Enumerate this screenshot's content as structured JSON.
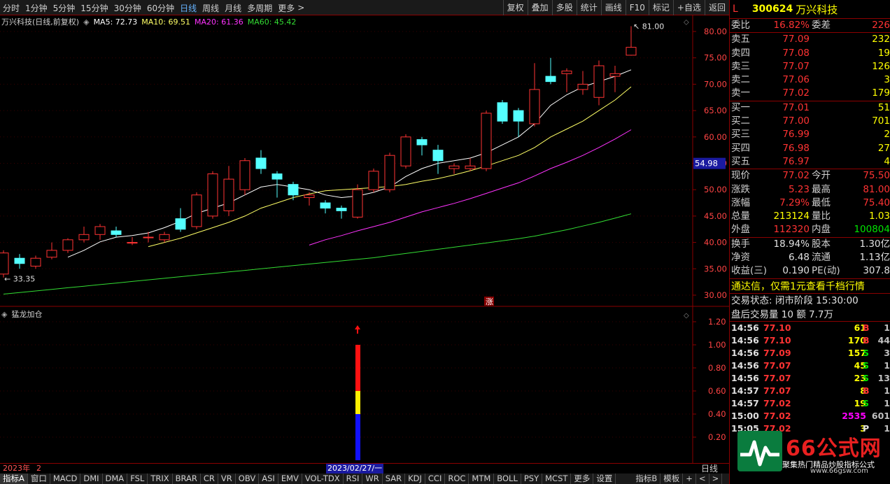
{
  "toolbar": {
    "periods": [
      "分时",
      "1分钟",
      "5分钟",
      "15分钟",
      "30分钟",
      "60分钟",
      "日线",
      "周线",
      "月线",
      "多周期",
      "更多"
    ],
    "active_period": "日线",
    "tools": [
      "复权",
      "叠加",
      "多股",
      "统计",
      "画线",
      "F10",
      "标记",
      "+自选",
      "返回"
    ]
  },
  "chart_info": {
    "title": "万兴科技(日线,前复权)",
    "ma5": "MA5: 72.73",
    "ma10": "MA10: 69.51",
    "ma20": "MA20: 61.36",
    "ma60": "MA60: 45.42"
  },
  "colors": {
    "up": "#ff3333",
    "down": "#54ffff",
    "ma5": "#ffffff",
    "ma10": "#ffff66",
    "ma20": "#ff33ff",
    "ma60": "#33dd33",
    "axis": "#8b0000"
  },
  "price_axis": {
    "ticks": [
      "80.00",
      "75.00",
      "70.00",
      "65.00",
      "60.00",
      "55.00",
      "50.00",
      "45.00",
      "40.00",
      "35.00",
      "30.00"
    ],
    "current_marker": "54.98"
  },
  "annotations": {
    "high_label": "81.00",
    "low_label": "33.35",
    "zhang_badge": "涨"
  },
  "indicator": {
    "title": "猛龙加仓",
    "ticks": [
      "1.20",
      "1.00",
      "0.80",
      "0.60",
      "0.40",
      "0.20"
    ]
  },
  "date_bar": {
    "year": "2023年",
    "count": "2",
    "cursor_date": "2023/02/27/一",
    "right_label": "日线"
  },
  "tabs": [
    "指标A",
    "窗口",
    "MACD",
    "DMI",
    "DMA",
    "FSL",
    "TRIX",
    "BRAR",
    "CR",
    "VR",
    "OBV",
    "ASI",
    "EMV",
    "VOL-TDX",
    "RSI",
    "WR",
    "SAR",
    "KDJ",
    "CCI",
    "ROC",
    "MTM",
    "BOLL",
    "PSY",
    "MCST",
    "更多",
    "设置",
    "指标B",
    "模板",
    "+",
    "<",
    ">"
  ],
  "stock": {
    "flag": "L",
    "code": "300624",
    "name": "万兴科技"
  },
  "order_book": {
    "weibi_label": "委比",
    "weibi_value": "16.82%",
    "weicha_label": "委差",
    "weicha_value": "226",
    "sell": [
      {
        "label": "卖五",
        "price": "77.09",
        "vol": "232"
      },
      {
        "label": "卖四",
        "price": "77.08",
        "vol": "19"
      },
      {
        "label": "卖三",
        "price": "77.07",
        "vol": "126"
      },
      {
        "label": "卖二",
        "price": "77.06",
        "vol": "3"
      },
      {
        "label": "卖一",
        "price": "77.02",
        "vol": "179"
      }
    ],
    "buy": [
      {
        "label": "买一",
        "price": "77.01",
        "vol": "51"
      },
      {
        "label": "买二",
        "price": "77.00",
        "vol": "701"
      },
      {
        "label": "买三",
        "price": "76.99",
        "vol": "2"
      },
      {
        "label": "买四",
        "price": "76.98",
        "vol": "27"
      },
      {
        "label": "买五",
        "price": "76.97",
        "vol": "4"
      }
    ]
  },
  "quote": [
    {
      "l1": "现价",
      "v1": "77.02",
      "l2": "今开",
      "v2": "75.50"
    },
    {
      "l1": "涨跌",
      "v1": "5.23",
      "l2": "最高",
      "v2": "81.00"
    },
    {
      "l1": "涨幅",
      "v1": "7.29%",
      "l2": "最低",
      "v2": "75.40"
    },
    {
      "l1": "总量",
      "v1": "213124",
      "l2": "量比",
      "v2": "1.03"
    },
    {
      "l1": "外盘",
      "v1": "112320",
      "l2": "内盘",
      "v2": "100804"
    }
  ],
  "fundamentals": [
    {
      "l1": "换手",
      "v1": "18.94%",
      "l2": "股本",
      "v2": "1.30亿"
    },
    {
      "l1": "净资",
      "v1": "6.48",
      "l2": "流通",
      "v2": "1.13亿"
    },
    {
      "l1": "收益(三)",
      "v1": "0.190",
      "l2": "PE(动)",
      "v2": "307.8"
    }
  ],
  "banner": "通达信，仅需1元查看千档行情",
  "trade_status": "交易状态: 闭市阶段 15:30:00",
  "after_hours": "盘后交易量 10 额 7.7万",
  "ticks_list": [
    {
      "t": "14:56",
      "p": "77.10",
      "v": "61",
      "s": "B",
      "n": "1"
    },
    {
      "t": "14:56",
      "p": "77.10",
      "v": "170",
      "s": "B",
      "n": "44"
    },
    {
      "t": "14:56",
      "p": "77.09",
      "v": "157",
      "s": "S",
      "n": "3"
    },
    {
      "t": "14:56",
      "p": "77.07",
      "v": "45",
      "s": "S",
      "n": "1"
    },
    {
      "t": "14:56",
      "p": "77.07",
      "v": "23",
      "s": "S",
      "n": "13"
    },
    {
      "t": "14:57",
      "p": "77.07",
      "v": "8",
      "s": "B",
      "n": "1"
    },
    {
      "t": "14:57",
      "p": "77.02",
      "v": "19",
      "s": "S",
      "n": "1"
    },
    {
      "t": "15:00",
      "p": "77.02",
      "v": "2535",
      "s": "",
      "n": "601"
    },
    {
      "t": "15:05",
      "p": "77.02",
      "v": "3",
      "s": "P",
      "n": "1"
    }
  ],
  "watermark": {
    "brand": "66公式网",
    "slogan": "聚集热门精品炒股指标公式",
    "url": "www.66gsw.com"
  },
  "candles": [
    [
      34.0,
      38.0,
      38.5,
      33.35
    ],
    [
      37.0,
      36.0,
      37.8,
      35.0
    ],
    [
      35.5,
      37.0,
      37.5,
      35.0
    ],
    [
      37.2,
      38.5,
      40.0,
      36.8
    ],
    [
      38.5,
      40.5,
      40.8,
      38.0
    ],
    [
      40.5,
      41.5,
      43.0,
      40.0
    ],
    [
      41.5,
      43.0,
      43.5,
      40.5
    ],
    [
      42.2,
      41.5,
      43.0,
      41.0
    ],
    [
      40.0,
      40.0,
      41.0,
      39.5
    ],
    [
      41.0,
      41.0,
      42.0,
      40.0
    ],
    [
      40.5,
      41.5,
      42.0,
      40.0
    ],
    [
      44.5,
      42.5,
      46.5,
      42.0
    ],
    [
      43.0,
      49.0,
      49.5,
      42.5
    ],
    [
      45.0,
      53.0,
      53.5,
      44.5
    ],
    [
      46.0,
      52.0,
      54.5,
      45.0
    ],
    [
      50.0,
      55.5,
      56.0,
      49.0
    ],
    [
      56.0,
      54.0,
      57.5,
      53.0
    ],
    [
      53.0,
      52.0,
      53.5,
      48.5
    ],
    [
      51.0,
      49.0,
      51.5,
      48.0
    ],
    [
      48.5,
      49.0,
      49.5,
      47.0
    ],
    [
      47.5,
      46.5,
      48.0,
      45.5
    ],
    [
      46.5,
      46.0,
      47.0,
      44.5
    ],
    [
      44.8,
      50.0,
      51.0,
      44.5
    ],
    [
      50.0,
      53.5,
      54.0,
      49.5
    ],
    [
      50.0,
      56.5,
      57.0,
      49.5
    ],
    [
      54.5,
      60.0,
      60.5,
      54.0
    ],
    [
      59.5,
      58.5,
      60.0,
      56.5
    ],
    [
      57.5,
      55.5,
      58.5,
      53.0
    ],
    [
      54.0,
      54.5,
      55.0,
      53.0
    ],
    [
      54.0,
      54.5,
      56.0,
      53.5
    ],
    [
      54.0,
      64.5,
      65.0,
      53.5
    ],
    [
      66.5,
      63.0,
      67.0,
      62.5
    ],
    [
      65.0,
      63.0,
      65.5,
      60.0
    ],
    [
      62.5,
      69.0,
      74.0,
      62.0
    ],
    [
      71.5,
      70.5,
      75.0,
      70.0
    ],
    [
      72.0,
      72.5,
      73.0,
      68.5
    ],
    [
      69.0,
      70.0,
      72.5,
      68.0
    ],
    [
      67.5,
      73.5,
      74.5,
      66.0
    ],
    [
      71.5,
      72.0,
      73.5,
      68.5
    ],
    [
      75.5,
      77.0,
      81.0,
      75.4
    ]
  ],
  "ma": {
    "ma5": [
      null,
      null,
      null,
      null,
      37.2,
      38.5,
      40.1,
      41.0,
      41.3,
      41.8,
      42.8,
      44.0,
      45.5,
      46.5,
      47.5,
      49.0,
      50.5,
      51.0,
      50.5,
      50.0,
      49.0,
      48.5,
      48.8,
      49.5,
      50.5,
      52.5,
      54.0,
      55.0,
      55.5,
      56.0,
      57.0,
      58.5,
      60.0,
      62.5,
      66.0,
      68.0,
      69.5,
      70.5,
      71.5,
      72.73
    ],
    "ma10": [
      null,
      null,
      null,
      null,
      null,
      null,
      null,
      null,
      null,
      39.2,
      40.0,
      40.8,
      41.8,
      42.8,
      43.8,
      45.0,
      46.5,
      47.5,
      48.5,
      49.2,
      49.8,
      50.0,
      50.2,
      50.4,
      50.6,
      51.0,
      51.6,
      52.1,
      52.8,
      53.6,
      54.5,
      55.5,
      56.5,
      58.0,
      60.0,
      61.5,
      63.0,
      65.0,
      67.0,
      69.51
    ],
    "ma20": [
      null,
      null,
      null,
      null,
      null,
      null,
      null,
      null,
      null,
      null,
      null,
      null,
      null,
      null,
      null,
      null,
      null,
      null,
      null,
      39.5,
      40.5,
      41.3,
      42.2,
      43.0,
      43.8,
      44.8,
      45.8,
      46.6,
      47.4,
      48.3,
      49.3,
      50.3,
      51.3,
      52.6,
      54.0,
      55.2,
      56.5,
      58.0,
      59.6,
      61.36
    ],
    "ma60": [
      30.2,
      30.5,
      30.8,
      31.1,
      31.4,
      31.7,
      32.0,
      32.3,
      32.6,
      32.9,
      33.2,
      33.5,
      33.8,
      34.1,
      34.4,
      34.7,
      35.0,
      35.3,
      35.6,
      35.9,
      36.2,
      36.5,
      36.8,
      37.1,
      37.5,
      37.9,
      38.3,
      38.7,
      39.1,
      39.5,
      39.9,
      40.3,
      40.7,
      41.2,
      41.8,
      42.4,
      43.1,
      43.8,
      44.6,
      45.42
    ]
  },
  "signal": {
    "index": 22,
    "red_top": 1.0,
    "red_bottom": 0.6,
    "yellow_bottom": 0.4,
    "blue_bottom": 0.0
  }
}
